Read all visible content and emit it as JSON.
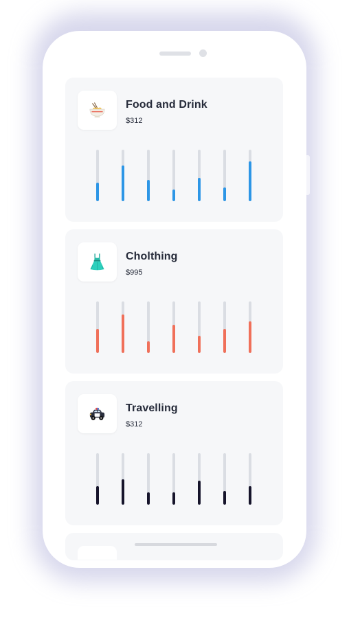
{
  "categories": [
    {
      "id": "food",
      "title": "Food and Drink",
      "amount": "$312",
      "icon": "noodle-bowl-icon",
      "color": "#2d96e6",
      "levels": [
        0.36,
        0.7,
        0.41,
        0.23,
        0.46,
        0.27,
        0.78
      ]
    },
    {
      "id": "clothing",
      "title": "Cholthing",
      "amount": "$995",
      "icon": "dress-icon",
      "color": "#f0705a",
      "levels": [
        0.47,
        0.75,
        0.23,
        0.55,
        0.33,
        0.47,
        0.61
      ]
    },
    {
      "id": "travel",
      "title": "Travelling",
      "amount": "$312",
      "icon": "police-car-icon",
      "color": "#16142b",
      "levels": [
        0.36,
        0.5,
        0.24,
        0.24,
        0.47,
        0.27,
        0.36
      ]
    }
  ]
}
